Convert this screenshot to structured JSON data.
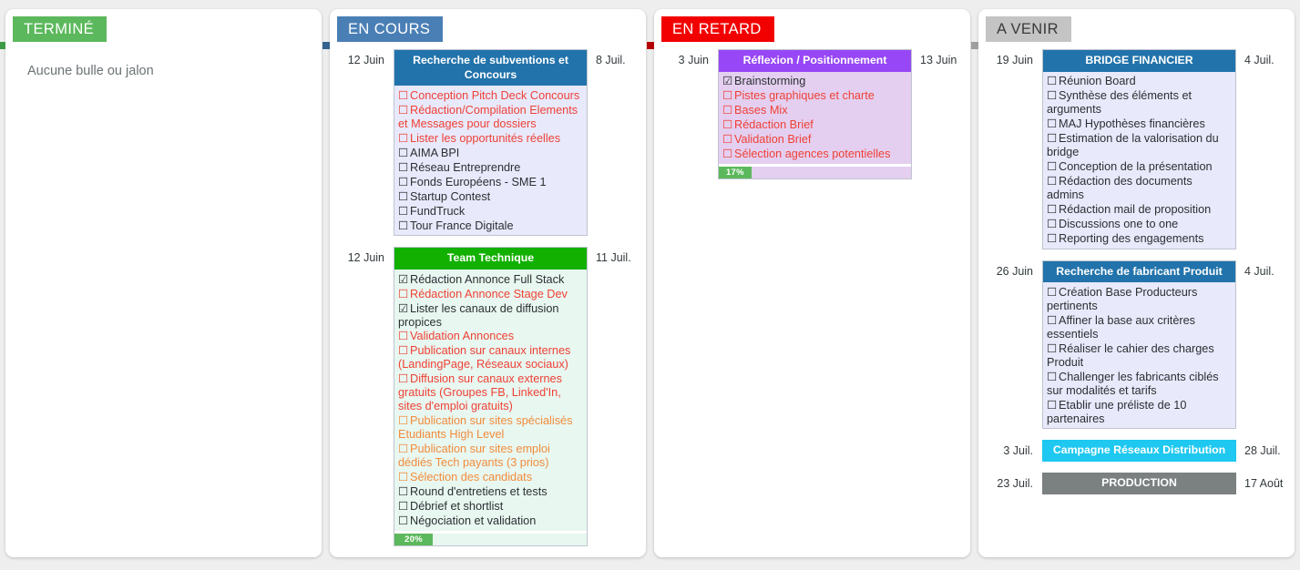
{
  "board": {
    "columns": [
      {
        "tab_label": "TERMINÉ",
        "tab_color": "#5cb85c",
        "tab_fold_color": "#3f9a47",
        "empty_text": "Aucune bulle ou jalon",
        "cards": []
      },
      {
        "tab_label": "EN COURS",
        "tab_color": "#4a7fb5",
        "tab_fold_color": "#35628f",
        "empty_text": "",
        "cards": [
          {
            "date_start": "12 Juin",
            "date_end": "8 Juil.",
            "title": "Recherche de subventions et Concours",
            "header_color": "#2273ab",
            "body_color": "#e8e9fb",
            "progress": null,
            "items": [
              {
                "label": "Conception Pitch Deck Concours",
                "state": "red",
                "checked": false
              },
              {
                "label": "Rédaction/Compilation Elements et Messages pour dossiers",
                "state": "red",
                "checked": false
              },
              {
                "label": "Lister les opportunités réelles",
                "state": "red",
                "checked": false
              },
              {
                "label": "AIMA BPI",
                "state": "normal",
                "checked": false
              },
              {
                "label": "Réseau Entreprendre",
                "state": "normal",
                "checked": false
              },
              {
                "label": "Fonds Européens - SME 1",
                "state": "normal",
                "checked": false
              },
              {
                "label": "Startup Contest",
                "state": "normal",
                "checked": false
              },
              {
                "label": "FundTruck",
                "state": "normal",
                "checked": false
              },
              {
                "label": "Tour France Digitale",
                "state": "normal",
                "checked": false
              }
            ]
          },
          {
            "date_start": "12 Juin",
            "date_end": "11 Juil.",
            "title": "Team Technique",
            "header_color": "#12b000",
            "body_color": "#e8f7f0",
            "progress": "20%",
            "items": [
              {
                "label": "Rédaction Annonce Full Stack",
                "state": "normal",
                "checked": true
              },
              {
                "label": "Rédaction Annonce Stage Dev",
                "state": "red",
                "checked": false
              },
              {
                "label": "Lister les canaux de diffusion propices",
                "state": "normal",
                "checked": true
              },
              {
                "label": "Validation Annonces",
                "state": "red",
                "checked": false
              },
              {
                "label": "Publication sur canaux internes (LandingPage, Réseaux sociaux)",
                "state": "red",
                "checked": false
              },
              {
                "label": "Diffusion sur canaux externes gratuits (Groupes FB, Linked'In, sites d'emploi gratuits)",
                "state": "red",
                "checked": false
              },
              {
                "label": "Publication sur sites spécialisés Etudiants High Level",
                "state": "orange",
                "checked": false
              },
              {
                "label": "Publication sur sites emploi dédiés Tech payants (3 prios)",
                "state": "orange",
                "checked": false
              },
              {
                "label": "Sélection des candidats",
                "state": "orange",
                "checked": false
              },
              {
                "label": "Round d'entretiens et tests",
                "state": "normal",
                "checked": false
              },
              {
                "label": "Débrief et shortlist",
                "state": "normal",
                "checked": false
              },
              {
                "label": "Négociation et validation",
                "state": "normal",
                "checked": false
              }
            ]
          }
        ]
      },
      {
        "tab_label": "EN RETARD",
        "tab_color": "#f20000",
        "tab_fold_color": "#b50000",
        "empty_text": "",
        "cards": [
          {
            "date_start": "3 Juin",
            "date_end": "13 Juin",
            "title": "Réflexion / Positionnement",
            "header_color": "#9747f5",
            "body_color": "#e4cff0",
            "progress": "17%",
            "items": [
              {
                "label": "Brainstorming",
                "state": "normal",
                "checked": true
              },
              {
                "label": "Pistes graphiques et charte",
                "state": "red",
                "checked": false
              },
              {
                "label": "Bases Mix",
                "state": "red",
                "checked": false
              },
              {
                "label": "Rédaction Brief",
                "state": "red",
                "checked": false
              },
              {
                "label": "Validation Brief",
                "state": "red",
                "checked": false
              },
              {
                "label": "Sélection agences potentielles",
                "state": "red",
                "checked": false
              }
            ]
          }
        ]
      },
      {
        "tab_label": "A VENIR",
        "tab_color": "#c4c4c4",
        "tab_fold_color": "#9e9e9e",
        "tab_text_color": "#3a3a3a",
        "empty_text": "",
        "cards": [
          {
            "date_start": "19 Juin",
            "date_end": "4 Juil.",
            "title": "BRIDGE FINANCIER",
            "header_color": "#2273ab",
            "body_color": "#e8e9fb",
            "progress": null,
            "items": [
              {
                "label": "Réunion Board",
                "state": "normal",
                "checked": false
              },
              {
                "label": "Synthèse des éléments et arguments",
                "state": "normal",
                "checked": false
              },
              {
                "label": "MAJ Hypothèses financières",
                "state": "normal",
                "checked": false
              },
              {
                "label": "Estimation de la valorisation du bridge",
                "state": "normal",
                "checked": false
              },
              {
                "label": "Conception de la présentation",
                "state": "normal",
                "checked": false
              },
              {
                "label": "Rédaction des documents admins",
                "state": "normal",
                "checked": false
              },
              {
                "label": "Rédaction mail de proposition",
                "state": "normal",
                "checked": false
              },
              {
                "label": "Discussions one to one",
                "state": "normal",
                "checked": false
              },
              {
                "label": "Reporting des engagements",
                "state": "normal",
                "checked": false
              }
            ]
          },
          {
            "date_start": "26 Juin",
            "date_end": "4 Juil.",
            "title": "Recherche de fabricant Produit",
            "header_color": "#2273ab",
            "body_color": "#e8e9fb",
            "progress": null,
            "items": [
              {
                "label": "Création Base Producteurs pertinents",
                "state": "normal",
                "checked": false
              },
              {
                "label": "Affiner la base aux critères essentiels",
                "state": "normal",
                "checked": false
              },
              {
                "label": "Réaliser le cahier des charges Produit",
                "state": "normal",
                "checked": false
              },
              {
                "label": "Challenger les fabricants ciblés sur modalités et tarifs",
                "state": "normal",
                "checked": false
              },
              {
                "label": "Etablir une préliste de 10 partenaires",
                "state": "normal",
                "checked": false
              }
            ]
          },
          {
            "date_start": "3 Juil.",
            "date_end": "28 Juil.",
            "title": "Campagne Réseaux Distribution",
            "header_color": "#1ec8f0",
            "body_color": "",
            "progress": null,
            "items": []
          },
          {
            "date_start": "23 Juil.",
            "date_end": "17 Août",
            "title": "PRODUCTION",
            "header_color": "#7b8080",
            "body_color": "",
            "progress": null,
            "items": []
          }
        ]
      }
    ]
  },
  "icons": {
    "checkbox_unchecked": "☐",
    "checkbox_checked": "☑"
  }
}
